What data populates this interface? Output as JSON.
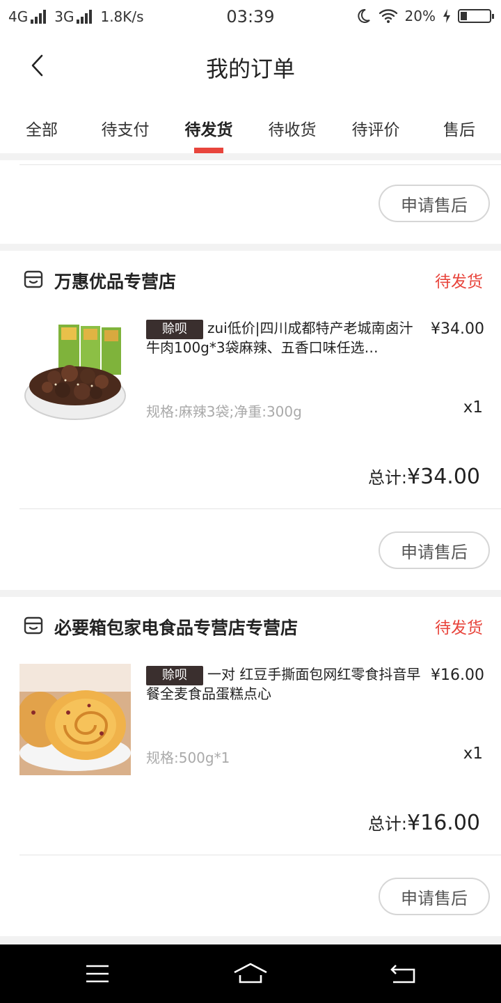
{
  "status_bar": {
    "network1": "4G",
    "network2": "3G",
    "speed": "1.8K/s",
    "time": "03:39",
    "battery": "20%"
  },
  "header": {
    "title": "我的订单"
  },
  "tabs": [
    {
      "label": "全部"
    },
    {
      "label": "待支付"
    },
    {
      "label": "待发货",
      "active": true
    },
    {
      "label": "待收货"
    },
    {
      "label": "待评价"
    },
    {
      "label": "售后"
    }
  ],
  "orders": [
    {
      "after_sale_label": "申请售后"
    },
    {
      "shop_name": "万惠优品专营店",
      "status": "待发货",
      "tag": "赊呗",
      "title": "zui低价|四川成都特产老城南卤汁牛肉100g*3袋麻辣、五香口味任选…",
      "price": "¥34.00",
      "spec": "规格:麻辣3袋;净重:300g",
      "qty": "x1",
      "total_label": "总计:",
      "total_value": "¥34.00",
      "after_sale_label": "申请售后"
    },
    {
      "shop_name": "必要箱包家电食品专营店专营店",
      "status": "待发货",
      "tag": "赊呗",
      "title": "一对 红豆手撕面包网红零食抖音早餐全麦食品蛋糕点心",
      "price": "¥16.00",
      "spec": "规格:500g*1",
      "qty": "x1",
      "total_label": "总计:",
      "total_value": "¥16.00",
      "after_sale_label": "申请售后"
    }
  ],
  "icons": {
    "back": "back-chevron-icon",
    "shop": "shop-icon",
    "menu": "menu-icon",
    "home": "home-icon",
    "return": "return-icon"
  },
  "colors": {
    "accent": "#e8453c",
    "tag_bg": "#3a2f2e"
  }
}
